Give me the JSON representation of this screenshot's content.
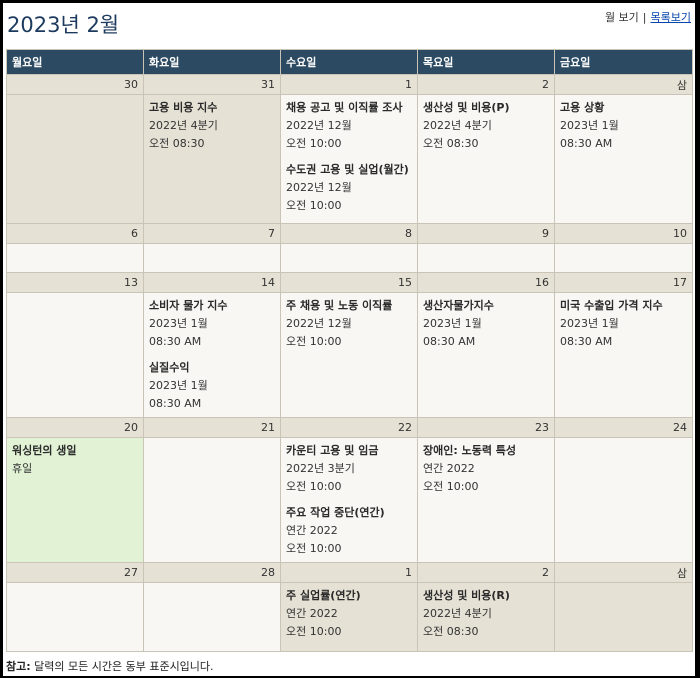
{
  "title": "2023년 2월",
  "view_links": {
    "month": "월 보기",
    "list": "목록보기"
  },
  "weekdays": [
    "월요일",
    "화요일",
    "수요일",
    "목요일",
    "금요일"
  ],
  "weeks": [
    {
      "days": [
        {
          "num": "30",
          "other": true,
          "events": []
        },
        {
          "num": "31",
          "other": true,
          "events": [
            {
              "title": "고용 비용 지수",
              "lines": [
                "2022년 4분기",
                "오전 08:30"
              ]
            }
          ]
        },
        {
          "num": "1",
          "events": [
            {
              "title": "채용 공고 및 이직률 조사",
              "lines": [
                "2022년 12월",
                "오전 10:00"
              ]
            },
            {
              "title": "수도권 고용 및 실업(월간)",
              "lines": [
                "2022년 12월",
                "오전 10:00"
              ]
            }
          ]
        },
        {
          "num": "2",
          "events": [
            {
              "title": "생산성 및 비용(P)",
              "lines": [
                "2022년 4분기",
                "오전 08:30"
              ]
            }
          ]
        },
        {
          "num": "삼",
          "events": [
            {
              "title": "고용 상황",
              "lines": [
                "2023년 1월",
                "08:30 AM"
              ]
            }
          ]
        }
      ]
    },
    {
      "days": [
        {
          "num": "6",
          "events": []
        },
        {
          "num": "7",
          "events": []
        },
        {
          "num": "8",
          "events": []
        },
        {
          "num": "9",
          "events": []
        },
        {
          "num": "10",
          "events": []
        }
      ]
    },
    {
      "days": [
        {
          "num": "13",
          "events": []
        },
        {
          "num": "14",
          "events": [
            {
              "title": "소비자 물가 지수",
              "lines": [
                "2023년 1월",
                "08:30 AM"
              ]
            },
            {
              "title": "실질수익",
              "lines": [
                "2023년 1월",
                "08:30 AM"
              ]
            }
          ]
        },
        {
          "num": "15",
          "events": [
            {
              "title": "주 채용 및 노동 이직률",
              "lines": [
                "2022년 12월",
                "오전 10:00"
              ]
            }
          ]
        },
        {
          "num": "16",
          "events": [
            {
              "title": "생산자물가지수",
              "lines": [
                "2023년 1월",
                "08:30 AM"
              ]
            }
          ]
        },
        {
          "num": "17",
          "events": [
            {
              "title": "미국 수출입 가격 지수",
              "lines": [
                "2023년 1월",
                "08:30 AM"
              ]
            }
          ]
        }
      ]
    },
    {
      "days": [
        {
          "num": "20",
          "holiday": true,
          "events": [
            {
              "title": "워싱턴의 생일",
              "lines": [
                "휴일"
              ]
            }
          ]
        },
        {
          "num": "21",
          "events": []
        },
        {
          "num": "22",
          "events": [
            {
              "title": "카운티 고용 및 임금",
              "lines": [
                "2022년 3분기",
                "오전 10:00"
              ]
            },
            {
              "title": "주요 작업 중단(연간)",
              "lines": [
                "연간 2022",
                "오전 10:00"
              ]
            }
          ]
        },
        {
          "num": "23",
          "events": [
            {
              "title": "장애인: 노동력 특성",
              "lines": [
                "연간 2022",
                "오전 10:00"
              ]
            }
          ]
        },
        {
          "num": "24",
          "events": []
        }
      ]
    },
    {
      "days": [
        {
          "num": "27",
          "events": []
        },
        {
          "num": "28",
          "events": []
        },
        {
          "num": "1",
          "other": true,
          "events": [
            {
              "title": "주 실업률(연간)",
              "lines": [
                "연간 2022",
                "오전 10:00"
              ]
            }
          ]
        },
        {
          "num": "2",
          "other": true,
          "events": [
            {
              "title": "생산성 및 비용(R)",
              "lines": [
                "2022년 4분기",
                "오전 08:30"
              ]
            }
          ]
        },
        {
          "num": "삼",
          "other": true,
          "events": []
        }
      ]
    }
  ],
  "note": {
    "label": "참고:",
    "text": " 달력의 모든 시간은 동부 표준시입니다."
  }
}
